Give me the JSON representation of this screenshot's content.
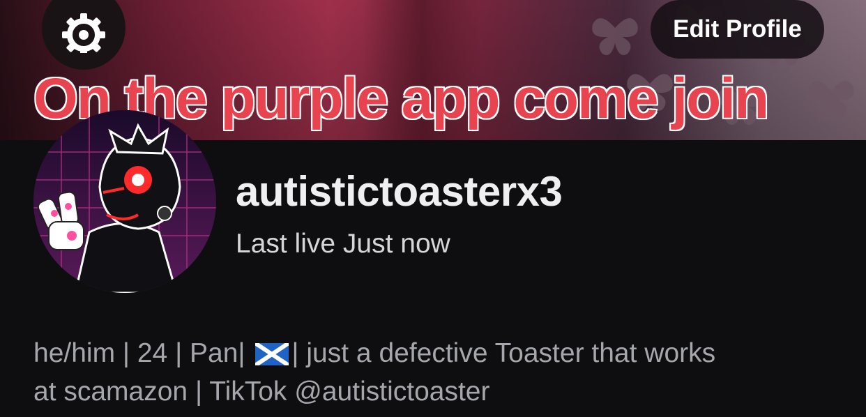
{
  "header": {
    "settings_icon": "gear-icon",
    "edit_profile_label": "Edit Profile",
    "overlay_caption": "On the purple app come join"
  },
  "profile": {
    "username": "autistictoasterx3",
    "last_live": "Last live Just now",
    "bio": {
      "line1_before_flag": "he/him | 24 | Pan|",
      "flag": "scotland-flag-icon",
      "line1_after_flag": "| just a defective Toaster that works",
      "line2": "at scamazon | TikTok @autistictoaster"
    }
  },
  "colors": {
    "background": "#0e0e10",
    "caption_red": "#e8444f",
    "username": "#efeff1",
    "bio_text": "#a6a6ad"
  }
}
